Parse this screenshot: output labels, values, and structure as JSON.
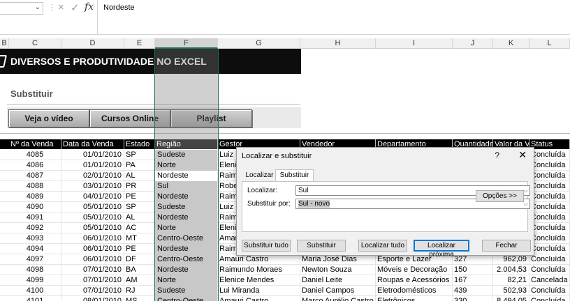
{
  "formula_bar": {
    "cancel_icon": "×",
    "confirm_icon": "✓",
    "fx_label": "fx",
    "formula_value": "Nordeste",
    "dots": "⋮"
  },
  "columns": [
    {
      "id": "col-B",
      "label": "B"
    },
    {
      "id": "col-C",
      "label": "C"
    },
    {
      "id": "col-D",
      "label": "D"
    },
    {
      "id": "col-E",
      "label": "E"
    },
    {
      "id": "col-F",
      "label": "F"
    },
    {
      "id": "col-G",
      "label": "G"
    },
    {
      "id": "col-H",
      "label": "H"
    },
    {
      "id": "col-I",
      "label": "I"
    },
    {
      "id": "col-J",
      "label": "J"
    },
    {
      "id": "col-K",
      "label": "K"
    },
    {
      "id": "col-L",
      "label": "L"
    }
  ],
  "banner": {
    "title_main": "DIVERSOS E PRODUTIVIDADE",
    "title_tail": " NO EXCEL"
  },
  "section": {
    "title": "Substituir"
  },
  "buttons": {
    "video": "Veja o vídeo",
    "courses": "Cursos Online",
    "playlist": "Playlist"
  },
  "table": {
    "headers": [
      "Nº da Venda",
      "Data da Venda",
      "Estado",
      "Região",
      "Gestor",
      "Vendedor",
      "Departamento",
      "Quantidade",
      "Valor da V",
      "Status"
    ],
    "rows": [
      [
        "4085",
        "01/01/2010",
        "SP",
        "Sudeste",
        "Luiz M",
        "",
        "",
        "",
        "",
        "Concluída"
      ],
      [
        "4086",
        "01/01/2010",
        "PA",
        "Norte",
        "Elenic",
        "",
        "",
        "",
        "",
        "Concluída"
      ],
      [
        "4087",
        "02/01/2010",
        "AL",
        "Nordeste",
        "Raim",
        "",
        "",
        "",
        "",
        "Concluída"
      ],
      [
        "4088",
        "03/01/2010",
        "PR",
        "Sul",
        "Robe",
        "",
        "",
        "",
        "",
        "Concluída"
      ],
      [
        "4089",
        "04/01/2010",
        "PE",
        "Nordeste",
        "Raim",
        "",
        "",
        "",
        "",
        "Concluída"
      ],
      [
        "4090",
        "05/01/2010",
        "SP",
        "Sudeste",
        "Luiz M",
        "",
        "",
        "",
        "",
        "Concluída"
      ],
      [
        "4091",
        "05/01/2010",
        "AL",
        "Nordeste",
        "Raim",
        "",
        "",
        "",
        "",
        "Concluída"
      ],
      [
        "4092",
        "05/01/2010",
        "AC",
        "Norte",
        "Elenic",
        "",
        "",
        "",
        "",
        "Concluída"
      ],
      [
        "4093",
        "06/01/2010",
        "MT",
        "Centro-Oeste",
        "Amau",
        "",
        "",
        "",
        "",
        "Concluída"
      ],
      [
        "4094",
        "06/01/2010",
        "PE",
        "Nordeste",
        "Raim",
        "",
        "",
        "",
        "",
        "Concluída"
      ],
      [
        "4097",
        "06/01/2010",
        "DF",
        "Centro-Oeste",
        "Amauri Castro",
        "Maria José Dias",
        "Esporte e Lazer",
        "327",
        "962,09",
        "Concluída"
      ],
      [
        "4098",
        "07/01/2010",
        "BA",
        "Nordeste",
        "Raimundo Moraes",
        "Newton Souza",
        "Móveis e Decoração",
        "150",
        "2.004,53",
        "Concluída"
      ],
      [
        "4099",
        "07/01/2010",
        "AM",
        "Norte",
        "Elenice Mendes",
        "Daniel Leite",
        "Roupas e Acessórios",
        "167",
        "82,21",
        "Cancelada"
      ],
      [
        "4100",
        "07/01/2010",
        "RJ",
        "Sudeste",
        "Lui Miranda",
        "Daniel Campos",
        "Eletrodomésticos",
        "439",
        "502,93",
        "Concluída"
      ],
      [
        "4101",
        "08/01/2010",
        "MS",
        "Centro-Oeste",
        "Amauri Castro",
        "Marco Aurélio Castro",
        "Eletrônicos",
        "330",
        "8.494,05",
        "Concluída"
      ]
    ]
  },
  "dialog": {
    "title": "Localizar e substituir",
    "help": "?",
    "close": "✕",
    "tab_find": "Localizar",
    "tab_replace": "Substituir",
    "find_label": "Localizar:",
    "find_value": "Sul",
    "replace_label": "Substituir por:",
    "replace_value": "Sul - novo",
    "options": "Opções >>",
    "replace_all": "Substituir tudo",
    "replace": "Substituir",
    "find_all": "Localizar tudo",
    "find_next": "Localizar próxima",
    "cancel": "Fechar"
  }
}
